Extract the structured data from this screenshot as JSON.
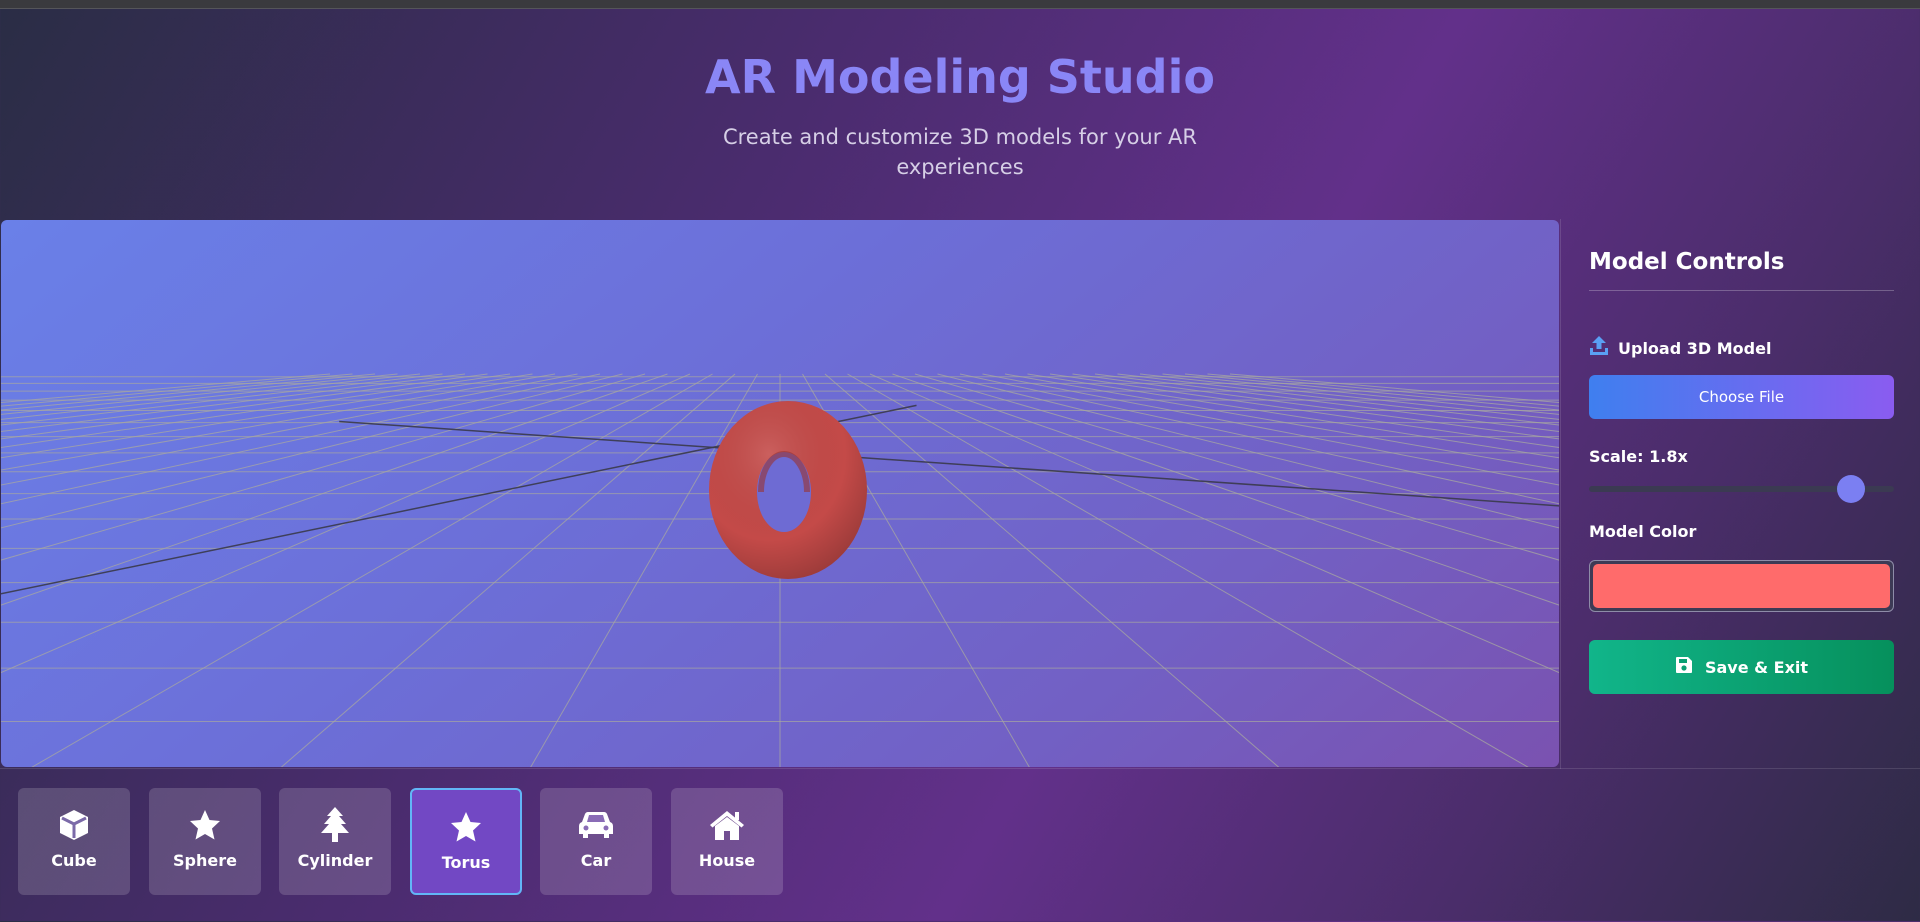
{
  "header": {
    "title": "AR Modeling Studio",
    "subtitle": "Create and customize 3D models for your AR experiences"
  },
  "viewport": {
    "model": "torus",
    "model_color": "#c44a48",
    "grid_color": "#a8a8a0",
    "background_from": "#6a80e8",
    "background_to": "#7a52b0"
  },
  "controls": {
    "title": "Model Controls",
    "upload_label": "Upload 3D Model",
    "upload_icon": "upload-icon",
    "choose_file_label": "Choose File",
    "scale_label": "Scale: 1.8x",
    "scale_fraction": 0.86,
    "color_label": "Model Color",
    "color_value": "#ff6b6b",
    "save_label": "Save & Exit",
    "save_icon": "floppy-disk-icon"
  },
  "shapes": [
    {
      "label": "Cube",
      "icon": "cube-icon",
      "active": false
    },
    {
      "label": "Sphere",
      "icon": "star-icon",
      "active": false
    },
    {
      "label": "Cylinder",
      "icon": "tree-icon",
      "active": false
    },
    {
      "label": "Torus",
      "icon": "star-icon",
      "active": true
    },
    {
      "label": "Car",
      "icon": "car-icon",
      "active": false
    },
    {
      "label": "House",
      "icon": "house-icon",
      "active": false
    }
  ]
}
